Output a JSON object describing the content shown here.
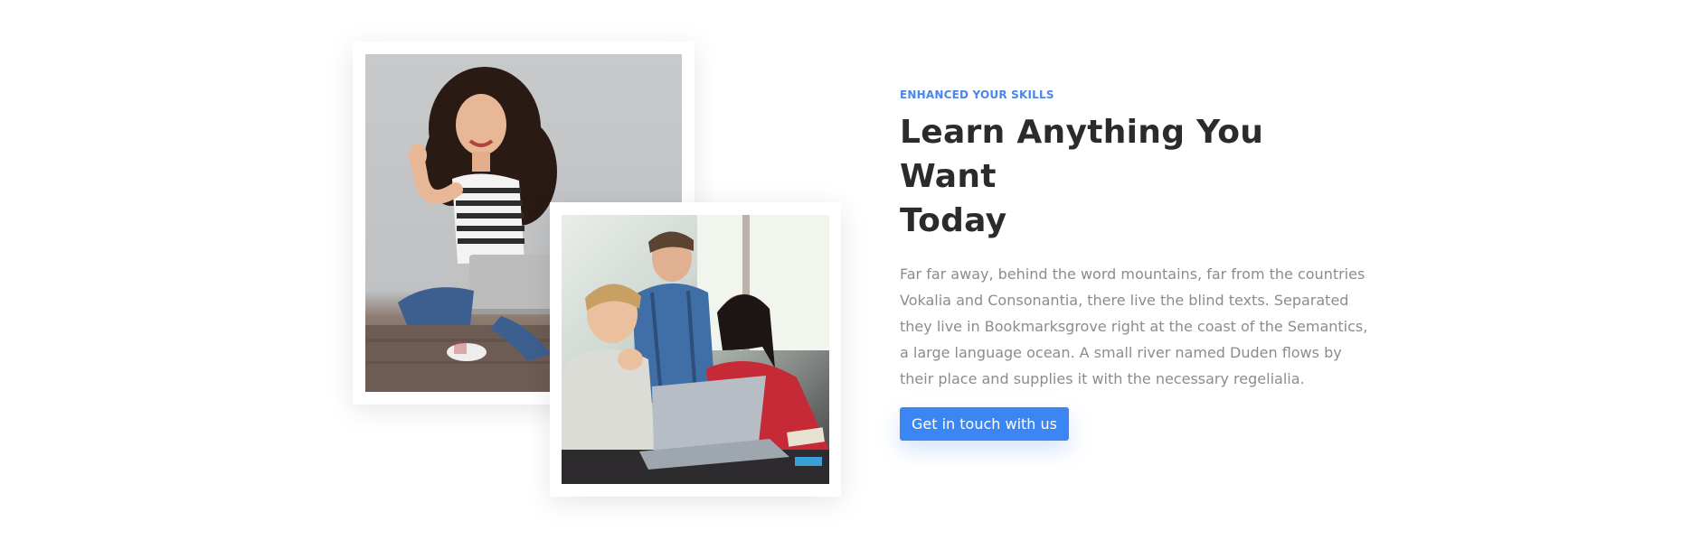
{
  "about": {
    "eyebrow": "ENHANCED YOUR SKILLS",
    "heading_line1": "Learn Anything You Want",
    "heading_line2": "Today",
    "body": "Far far away, behind the word mountains, far from the countries Vokalia and Consonantia, there live the blind texts. Separated they live in Bookmarksgrove right at the coast of the Semantics, a large language ocean. A small river named Duden flows by their place and supplies it with the necessary regelialia.",
    "cta_label": "Get in touch with us"
  },
  "colors": {
    "accent": "#4a86e8",
    "button": "#3c86f3",
    "heading": "#2b2b2b",
    "body": "#8c8c8c"
  }
}
